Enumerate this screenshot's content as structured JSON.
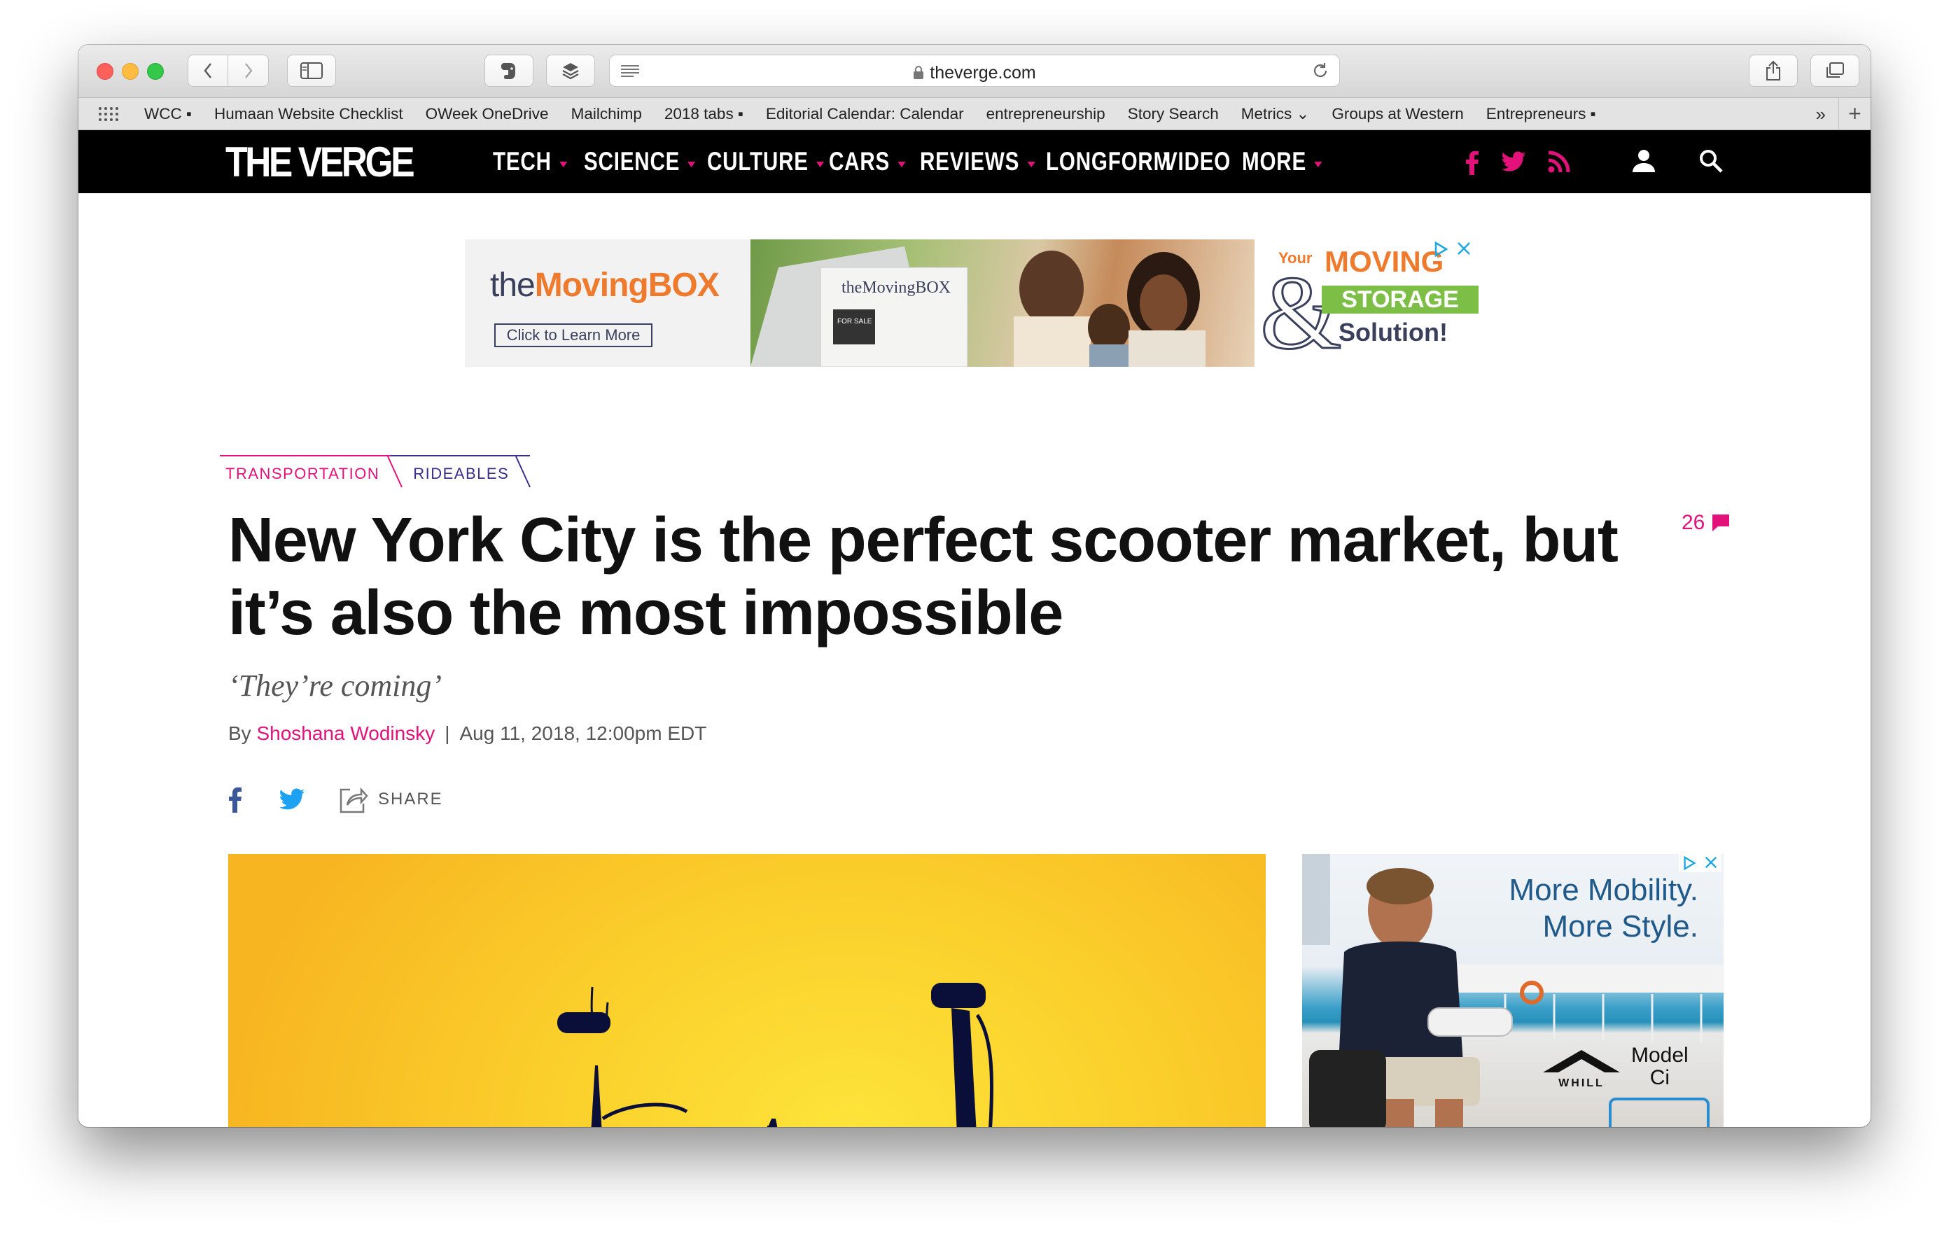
{
  "browser": {
    "url": "theverge.com",
    "bookmarks": [
      "WCC ▪",
      "Humaan Website Checklist",
      "OWeek OneDrive",
      "Mailchimp",
      "2018 tabs ▪",
      "Editorial Calendar: Calendar",
      "entrepreneurship",
      "Story Search",
      "Metrics ⌄",
      "Groups at Western",
      "Entrepreneurs ▪"
    ],
    "bookmarks_overflow": "»",
    "new_tab": "+"
  },
  "site": {
    "logo": "THE VERGE",
    "accent": "#e2127a",
    "nav": [
      {
        "label": "TECH",
        "dropdown": true
      },
      {
        "label": "SCIENCE",
        "dropdown": true
      },
      {
        "label": "CULTURE",
        "dropdown": true
      },
      {
        "label": "CARS",
        "dropdown": true
      },
      {
        "label": "REVIEWS",
        "dropdown": true
      },
      {
        "label": "LONGFORM",
        "dropdown": false
      },
      {
        "label": "VIDEO",
        "dropdown": false
      },
      {
        "label": "MORE",
        "dropdown": true
      }
    ]
  },
  "top_ad": {
    "brand_prefix": "the",
    "brand_main": "MovingBOX",
    "cta": "Click to Learn More",
    "truck_text": "theMovingBOX",
    "sign_text": "FOR SALE",
    "your": "Your",
    "moving": "MOVING",
    "storage": "STORAGE",
    "amp": "&",
    "solution": "Solution!"
  },
  "article": {
    "tags": [
      "TRANSPORTATION",
      "RIDEABLES"
    ],
    "headline": "New York City is the perfect scooter market, but it’s also the most impossible",
    "comment_count": "26",
    "dek": "‘They’re coming’",
    "byline_prefix": "By",
    "author": "Shoshana Wodinsky",
    "byline_sep": "|",
    "date": "Aug 11, 2018, 12:00pm EDT",
    "share_label": "SHARE"
  },
  "side_ad": {
    "line1": "More Mobility.",
    "line2": "More Style.",
    "brand": "WHILL",
    "model": "Model",
    "model_name": "Ci"
  }
}
